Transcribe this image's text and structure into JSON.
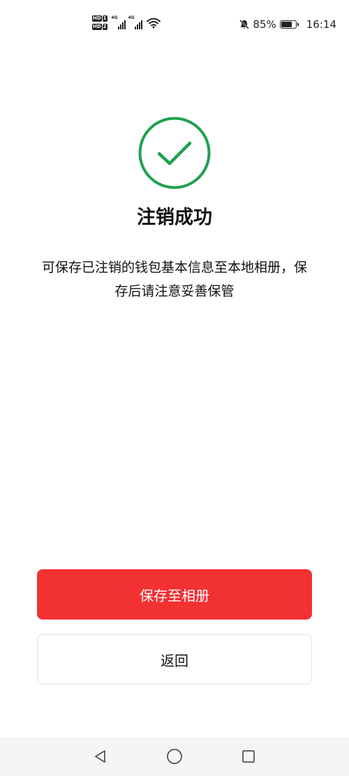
{
  "status_bar": {
    "hd1": "HD",
    "hd1_num": "1",
    "hd2": "HD",
    "hd2_num": "2",
    "network1": "4G",
    "network2": "4G",
    "icons": [
      "signal-icon",
      "signal-icon",
      "wifi-icon",
      "bell-muted-icon",
      "battery-icon"
    ],
    "battery_percent": "85%",
    "battery_level": 0.85,
    "time": "16:14"
  },
  "result": {
    "icon": "check-circle-icon",
    "icon_color": "#1fa14e",
    "title": "注销成功",
    "description": "可保存已注销的钱包基本信息至本地相册，保存后请注意妥善保管"
  },
  "actions": {
    "save_label": "保存至相册",
    "back_label": "返回",
    "primary_color": "#f23133"
  },
  "nav_bar": {
    "icons": [
      "back-triangle-icon",
      "home-circle-icon",
      "recents-square-icon"
    ]
  }
}
